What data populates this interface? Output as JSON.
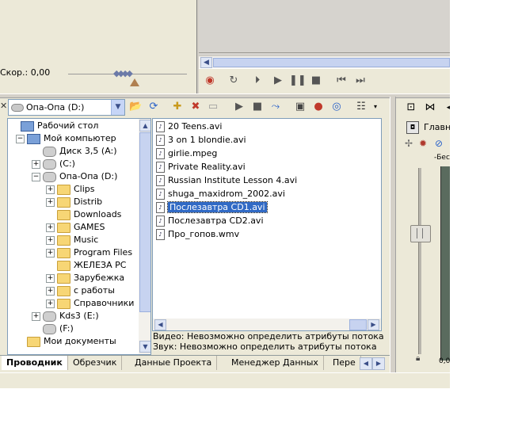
{
  "speed": {
    "label": "Скор.: 0,00"
  },
  "transport": {
    "icons": [
      "record-icon",
      "loop-icon",
      "play-from-start-icon",
      "play-icon",
      "pause-icon",
      "stop-icon",
      "prev-marker-icon",
      "next-marker-icon"
    ]
  },
  "explorer": {
    "drive_selected": "Опа-Опа (D:)",
    "toolbar_icons": [
      "up-folder-icon",
      "refresh-icon",
      "new-folder-icon",
      "delete-icon",
      "views-icon",
      "play-icon",
      "stop-icon",
      "autopreview-icon",
      "add-to-project-icon",
      "start-preview-icon",
      "properties-icon",
      "view-menu-icon"
    ],
    "tree": [
      {
        "label": "Рабочий стол",
        "depth": 0,
        "icon": "desktop-icon",
        "expander": ""
      },
      {
        "label": "Мой компьютер",
        "depth": 1,
        "icon": "computer-icon",
        "expander": "−"
      },
      {
        "label": "Диск 3,5 (A:)",
        "depth": 2,
        "icon": "floppy-icon",
        "expander": ""
      },
      {
        "label": "(C:)",
        "depth": 2,
        "icon": "drive-icon",
        "expander": "+"
      },
      {
        "label": "Опа-Опа (D:)",
        "depth": 2,
        "icon": "drive-icon",
        "expander": "−"
      },
      {
        "label": "Clips",
        "depth": 3,
        "icon": "folder-icon",
        "expander": "+"
      },
      {
        "label": "Distrib",
        "depth": 3,
        "icon": "folder-icon",
        "expander": "+"
      },
      {
        "label": "Downloads",
        "depth": 3,
        "icon": "folder-icon",
        "expander": ""
      },
      {
        "label": "GAMES",
        "depth": 3,
        "icon": "folder-icon",
        "expander": "+"
      },
      {
        "label": "Music",
        "depth": 3,
        "icon": "music-folder-icon",
        "expander": "+"
      },
      {
        "label": "Program Files",
        "depth": 3,
        "icon": "folder-icon",
        "expander": "+"
      },
      {
        "label": "ЖЕЛЕЗА PC",
        "depth": 3,
        "icon": "folder-icon",
        "expander": ""
      },
      {
        "label": "Зарубежка",
        "depth": 3,
        "icon": "folder-icon",
        "expander": "+"
      },
      {
        "label": "с работы",
        "depth": 3,
        "icon": "folder-icon",
        "expander": "+"
      },
      {
        "label": "Справочники",
        "depth": 3,
        "icon": "folder-icon",
        "expander": "+"
      },
      {
        "label": "Kds3 (E:)",
        "depth": 2,
        "icon": "cd-drive-icon",
        "expander": "+"
      },
      {
        "label": "(F:)",
        "depth": 2,
        "icon": "cd-drive-icon",
        "expander": ""
      },
      {
        "label": "Мои документы",
        "depth": 1,
        "icon": "folder-icon",
        "expander": ""
      }
    ],
    "files": [
      {
        "name": "20 Teens.avi",
        "selected": false
      },
      {
        "name": "3 on 1 blondie.avi",
        "selected": false
      },
      {
        "name": "girlie.mpeg",
        "selected": false
      },
      {
        "name": "Private Reality.avi",
        "selected": false
      },
      {
        "name": "Russian Institute Lesson 4.avi",
        "selected": false
      },
      {
        "name": "shuga_maxidrom_2002.avi",
        "selected": false
      },
      {
        "name": "Послезавтра CD1.avi",
        "selected": true
      },
      {
        "name": "Послезавтра CD2.avi",
        "selected": false
      },
      {
        "name": "Про_гопов.wmv",
        "selected": false
      }
    ],
    "status_video": "Видео: Невозможно определить атрибуты потока",
    "status_audio": "Звук: Невозможно определить атрибуты потока"
  },
  "tabs": [
    "Проводник",
    "Обрезчик",
    "Данные Проекта",
    "Менеджер Данных",
    "Пере"
  ],
  "right_panel": {
    "tab_label": "Главни",
    "sub_label": "-Бес",
    "level_value": "0,0"
  },
  "colors": {
    "selection": "#316ac5",
    "panel": "#ece9d8",
    "border": "#7f9db9"
  }
}
